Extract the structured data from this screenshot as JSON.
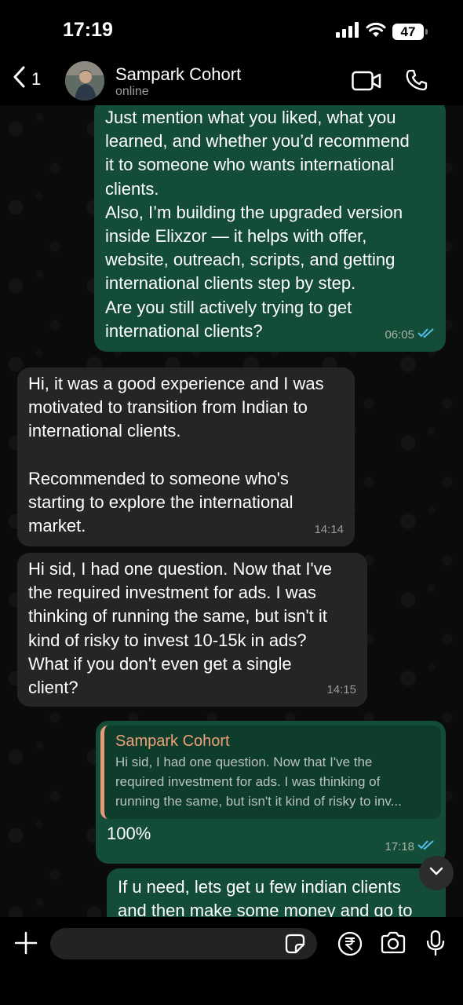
{
  "status_bar": {
    "time": "17:19",
    "battery": "47"
  },
  "header": {
    "back_count": "1",
    "title": "Sampark Cohort",
    "subtitle": "online"
  },
  "messages": [
    {
      "direction": "out",
      "text": "Just mention what you liked, what you\nlearned, and whether you’d recommend\nit to someone who wants international\nclients.\nAlso, I’m building the upgraded version\ninside Elixzor — it helps with offer,\nwebsite, outreach, scripts, and getting\ninternational clients step by step.\nAre you still actively trying to get\ninternational clients?",
      "time": "06:05",
      "status": "read"
    },
    {
      "direction": "in",
      "text": "Hi, it was a good experience and I was\nmotivated to transition from Indian to\ninternational clients.\n\nRecommended to someone who's\nstarting to explore the international\nmarket.",
      "time": "14:14"
    },
    {
      "direction": "in",
      "text": "Hi sid, I had one question. Now that I've\nthe required investment for ads. I was\nthinking of running the same, but isn't it\nkind of risky to invest 10-15k in ads?\nWhat if you don't even get a single\nclient?",
      "time": "14:15"
    },
    {
      "direction": "out",
      "quote": {
        "author": "Sampark Cohort",
        "text": "Hi sid, I had one question. Now that I've the\nrequired investment for ads. I was thinking of\nrunning the same, but isn't it kind of risky to inv..."
      },
      "text": "100%",
      "time": "17:18",
      "status": "read"
    },
    {
      "direction": "out",
      "text": "If u need, lets get u few indian clients\nand then make some money and go to"
    }
  ],
  "composer": {
    "placeholder": ""
  },
  "colors": {
    "outgoing_bubble": "#144d37",
    "incoming_bubble": "#242626",
    "read_ticks": "#53bdeb",
    "quote_accent": "#e39a77"
  },
  "icons": {
    "status": [
      "signal-icon",
      "wifi-icon",
      "battery-icon"
    ],
    "header": [
      "back-chevron-icon",
      "video-call-icon",
      "voice-call-icon"
    ],
    "composer": [
      "plus-icon",
      "sticker-icon",
      "rupee-payment-icon",
      "camera-icon",
      "microphone-icon"
    ],
    "chat": [
      "scroll-down-chevron-icon",
      "double-check-icon"
    ]
  }
}
